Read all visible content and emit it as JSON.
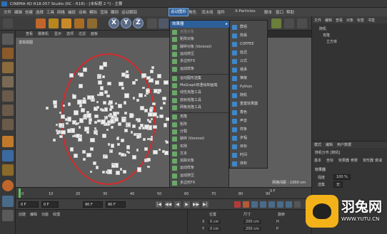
{
  "window": {
    "title": "CINEMA 4D R18.057 Studio (RC - R18) - [未标题 2 *] - 主要"
  },
  "menubar": {
    "items": [
      "文件",
      "编辑",
      "创建",
      "选择",
      "工具",
      "网格",
      "捕捉",
      "动画",
      "模拟",
      "渲染",
      "雕刻",
      "运动跟踪",
      "运动图形",
      "角色",
      "流水线",
      "插件",
      "X-Particles",
      "脚本",
      "窗口",
      "帮助"
    ],
    "active": "运动图形"
  },
  "toolbar": {
    "axes": [
      "X",
      "Y",
      "Z"
    ]
  },
  "viewport": {
    "menu": [
      "查看",
      "摄像机",
      "显示",
      "选项",
      "过滤",
      "面板"
    ],
    "label": "透视视图",
    "grid_info": "网格间距 : 1000 cm"
  },
  "mograph_menu": {
    "header": "效果器",
    "items": [
      {
        "label": "克隆对象",
        "dim": true
      },
      {
        "label": "矩阵对象",
        "dim": false
      },
      {
        "label": "破碎对象 (Voronoi)",
        "dim": false
      },
      {
        "label": "运动挤压",
        "dim": false
      },
      {
        "label": "多边形FX",
        "dim": false
      },
      {
        "label": "运动样条",
        "dim": false
      },
      {
        "label": "运动图形选集",
        "dim": false
      },
      {
        "label": "MoGraph权重绘制画笔",
        "dim": false
      },
      {
        "label": "线性克隆工具",
        "dim": false
      },
      {
        "label": "放射克隆工具",
        "dim": false
      },
      {
        "label": "网格克隆工具",
        "dim": false
      },
      {
        "label": "克隆",
        "dim": false
      },
      {
        "label": "矩阵",
        "dim": false
      },
      {
        "label": "分裂",
        "dim": false
      },
      {
        "label": "破碎 (Voronoi)",
        "dim": false
      },
      {
        "label": "实例",
        "dim": false
      },
      {
        "label": "文本",
        "dim": false
      },
      {
        "label": "追踪对象",
        "dim": false
      },
      {
        "label": "运动样条",
        "dim": false
      },
      {
        "label": "运动挤压",
        "dim": false
      },
      {
        "label": "多边形FX",
        "dim": false
      }
    ]
  },
  "effector_submenu": {
    "items": [
      "群组",
      "简易",
      "COFFEE",
      "延迟",
      "公式",
      "继承",
      "推散",
      "Python",
      "随机",
      "重置效果器",
      "着色",
      "声音",
      "样条",
      "步幅",
      "目标",
      "时间",
      "体积"
    ]
  },
  "objects_panel": {
    "tabs": [
      "文件",
      "编辑",
      "查看",
      "对象",
      "标签",
      "书签"
    ],
    "rows": [
      "随机",
      "克隆",
      "立方体"
    ]
  },
  "attributes_panel": {
    "tabs": [
      "模式",
      "编辑",
      "用户数据"
    ],
    "object": "随机分布 [随机]",
    "subtabs": [
      "基本",
      "坐标",
      "效果器",
      "参数",
      "变形器",
      "衰减"
    ],
    "section": "效果器",
    "field_label": "强度",
    "field_value": "100 %",
    "field2_label": "选集",
    "field2_value": "无"
  },
  "timeline": {
    "ticks": [
      "0",
      "10",
      "20",
      "30",
      "40",
      "50",
      "60",
      "70",
      "80",
      "90"
    ],
    "end_label": "0 F"
  },
  "transport": {
    "start": "0 F",
    "current": "0 F",
    "end": "90 F",
    "end2": "90 F",
    "buttons": [
      "|◀",
      "◀◀",
      "◀",
      "▶",
      "▶▶",
      "▶|"
    ]
  },
  "materials": {
    "tabs": [
      "创建",
      "编辑",
      "功能",
      "纹理"
    ]
  },
  "coords": {
    "headers": [
      "位置",
      "尺寸",
      "旋转"
    ],
    "rows": [
      {
        "axis": "X",
        "pos": "0 cm",
        "size": "200 cm",
        "rot": "H"
      },
      {
        "axis": "Y",
        "pos": "0 cm",
        "size": "200 cm",
        "rot": "P"
      }
    ]
  },
  "watermark": {
    "title": "羽兔网",
    "url": "WWW.YUTU.CN"
  },
  "colors": {
    "accent": "#2d5f9a",
    "annotation": "#d42a2a",
    "logo": "#f3b219"
  }
}
